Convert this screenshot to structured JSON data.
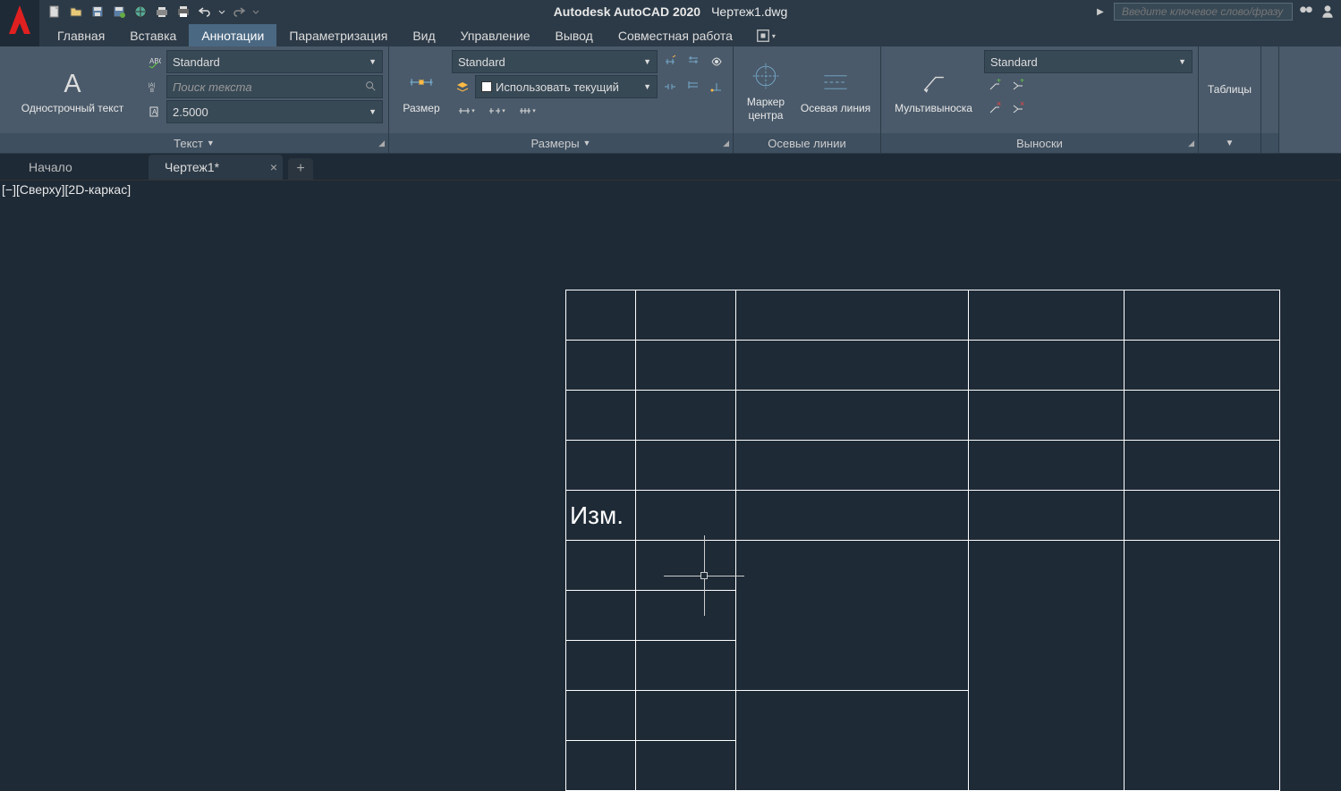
{
  "title": {
    "app": "Autodesk AutoCAD 2020",
    "file": "Чертеж1.dwg"
  },
  "search_placeholder": "Введите ключевое слово/фразу",
  "menu_tabs": [
    "Главная",
    "Вставка",
    "Аннотации",
    "Параметризация",
    "Вид",
    "Управление",
    "Вывод",
    "Совместная работа"
  ],
  "menu_active_index": 2,
  "ribbon": {
    "text": {
      "title": "Текст",
      "big_label": "Однострочный текст",
      "style": "Standard",
      "find_ph": "Поиск текста",
      "height": "2.5000"
    },
    "dim": {
      "title": "Размеры",
      "big_label": "Размер",
      "style": "Standard",
      "layer": "Использовать текущий"
    },
    "center": {
      "title": "Осевые линии",
      "marker": "Маркер\nцентра",
      "line": "Осевая линия"
    },
    "leader": {
      "title": "Выноски",
      "big_label": "Мультивыноска",
      "style": "Standard"
    },
    "table": {
      "big_label": "Таблицы"
    }
  },
  "doc_tabs": {
    "start": "Начало",
    "active": "Чертеж1*"
  },
  "view_label": "[−][Сверху][2D-каркас]",
  "drawing_text": "Изм."
}
